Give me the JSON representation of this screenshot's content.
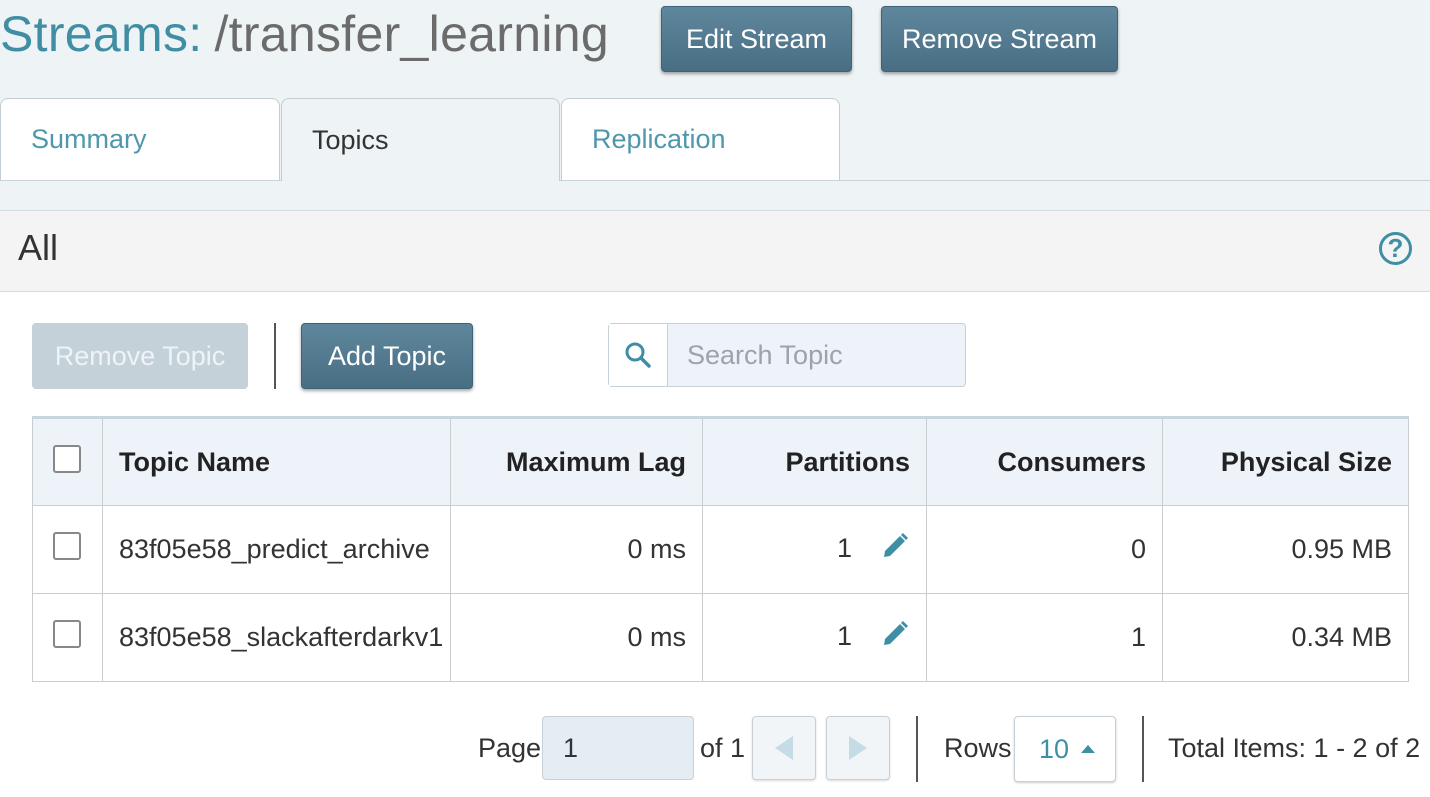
{
  "header": {
    "title_prefix": "Streams:",
    "title_path": "/transfer_learning",
    "edit_label": "Edit Stream",
    "remove_label": "Remove Stream"
  },
  "tabs": [
    {
      "label": "Summary",
      "active": false
    },
    {
      "label": "Topics",
      "active": true
    },
    {
      "label": "Replication",
      "active": false
    }
  ],
  "panel": {
    "title": "All",
    "help_glyph": "?",
    "remove_topic_label": "Remove Topic",
    "add_topic_label": "Add Topic",
    "search_placeholder": "Search Topic"
  },
  "table": {
    "columns": [
      "Topic Name",
      "Maximum Lag",
      "Partitions",
      "Consumers",
      "Physical Size"
    ],
    "rows": [
      {
        "name": "83f05e58_predict_archive",
        "lag": "0 ms",
        "partitions": "1",
        "consumers": "0",
        "size": "0.95 MB"
      },
      {
        "name": "83f05e58_slackafterdarkv1",
        "lag": "0 ms",
        "partitions": "1",
        "consumers": "1",
        "size": "0.34 MB"
      }
    ]
  },
  "pager": {
    "page_label": "Page",
    "page_value": "1",
    "of_label": "of 1",
    "rows_label": "Rows",
    "rows_value": "10",
    "total_label": "Total Items: 1 - 2 of 2"
  },
  "colors": {
    "accent": "#3e8fa3",
    "button": "#4f768b",
    "background": "#eef3f6"
  }
}
